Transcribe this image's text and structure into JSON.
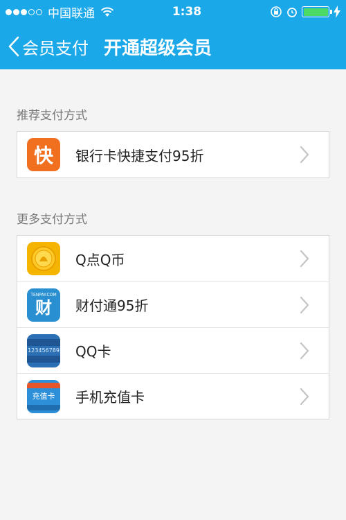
{
  "status_bar": {
    "carrier": "中国联通",
    "time": "1:38"
  },
  "nav": {
    "back_label": "会员支付",
    "title": "开通超级会员"
  },
  "recommended": {
    "label": "推荐支付方式",
    "items": [
      {
        "label": "银行卡快捷支付95折",
        "icon": "kuai-icon",
        "icon_text": "快"
      }
    ]
  },
  "more": {
    "label": "更多支付方式",
    "items": [
      {
        "label": "Q点Q币",
        "icon": "q-coin-icon"
      },
      {
        "label": "财付通95折",
        "icon": "tenpay-icon",
        "icon_top": "TENPAY.COM",
        "icon_text": "财"
      },
      {
        "label": "QQ卡",
        "icon": "qq-card-icon",
        "icon_text": "123456789"
      },
      {
        "label": "手机充值卡",
        "icon": "phone-card-icon",
        "icon_text": "充值卡"
      }
    ]
  },
  "colors": {
    "header": "#1aa8e8",
    "battery": "#4cd964"
  }
}
